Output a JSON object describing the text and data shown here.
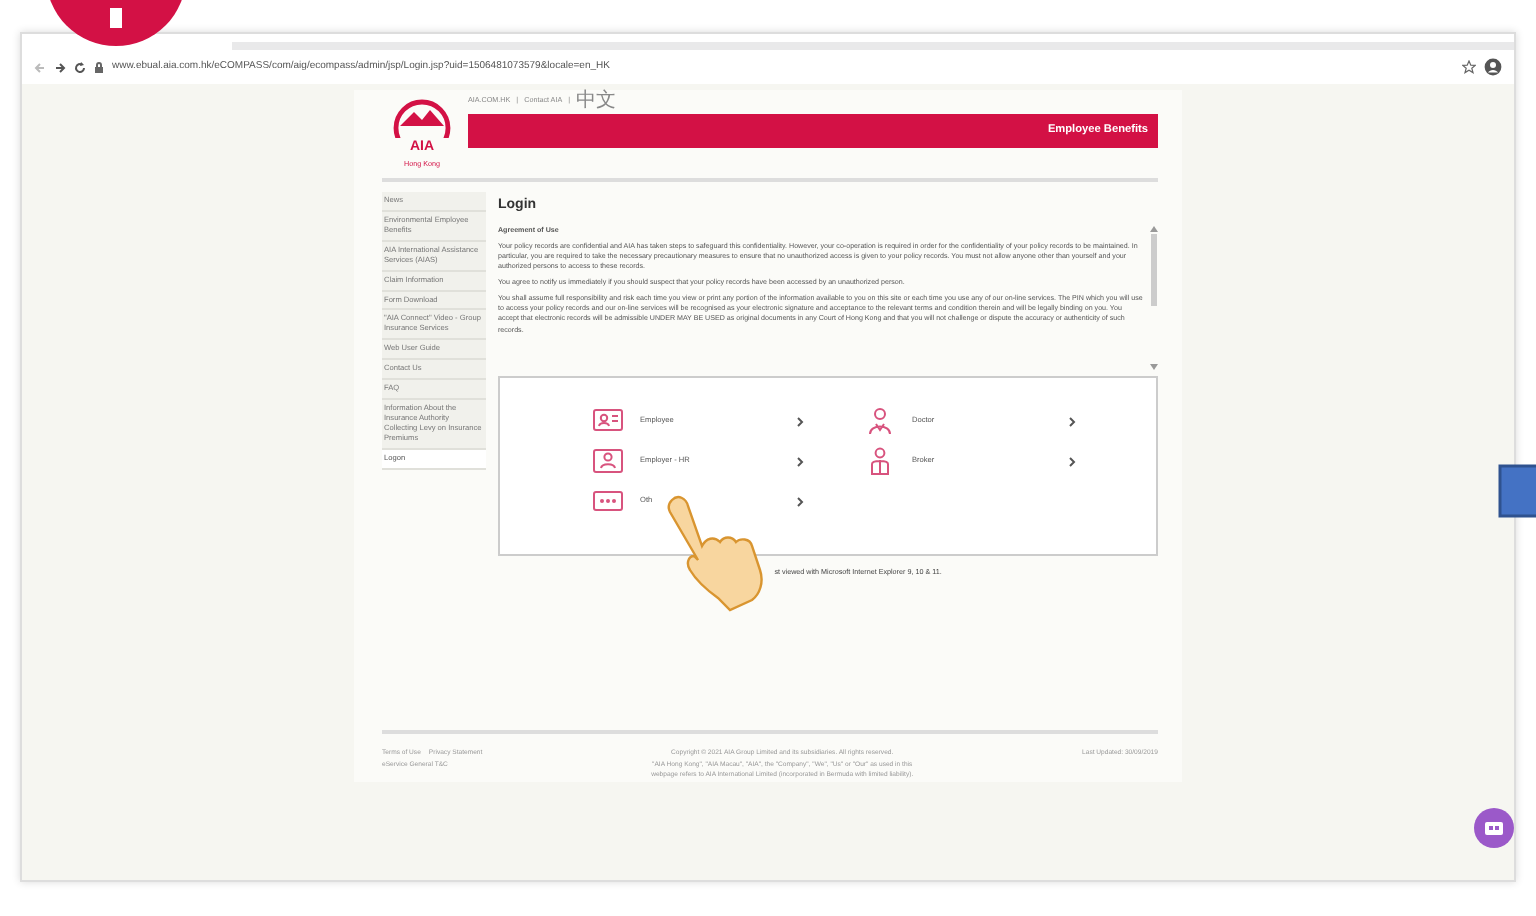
{
  "browser": {
    "url": "www.ebual.aia.com.hk/eCOMPASS/com/aig/ecompass/admin/jsp/Login.jsp?uid=1506481073579&locale=en_HK"
  },
  "header": {
    "logo_text": "AIA",
    "logo_caption": "Hong Kong",
    "top_links": [
      "AIA.COM.HK",
      "|",
      "Contact AIA",
      "|",
      "中文"
    ],
    "banner_title": "Employee Benefits"
  },
  "sidebar": {
    "items": [
      {
        "label": "News",
        "selected": false
      },
      {
        "label": "Environmental Employee Benefits",
        "selected": false
      },
      {
        "label": "AIA International Assistance Services (AIAS)",
        "selected": false
      },
      {
        "label": "Claim Information",
        "selected": false
      },
      {
        "label": "Form Download",
        "selected": false
      },
      {
        "label": "\"AIA Connect\" Video - Group Insurance Services",
        "selected": false
      },
      {
        "label": "Web User Guide",
        "selected": false
      },
      {
        "label": "Contact Us",
        "selected": false
      },
      {
        "label": "FAQ",
        "selected": false
      },
      {
        "label": "Information About the Insurance Authority Collecting Levy on Insurance Premiums",
        "selected": false
      },
      {
        "label": "Logon",
        "selected": true
      }
    ]
  },
  "main": {
    "title": "Login",
    "agreement_heading": "Agreement of Use",
    "paragraphs": [
      "Your policy records are confidential and AIA has taken steps to safeguard this confidentiality. However, your co-operation is required in order for the confidentiality of your policy records to be maintained. In particular, you are required to take the necessary precautionary measures to ensure that no unauthorized access is given to your policy records. You must not allow anyone other than yourself and your authorized persons to access to these records.",
      "You agree to notify us immediately if you should suspect that your policy records have been accessed by an unauthorized person.",
      "You shall assume full responsibility and risk each time you view or print any portion of the information available to you on this site or each time you use any of our on-line services. The PIN which you will use to access your policy records and our on-line services will be recognised as your electronic signature and acceptance to the relevant terms and condition therein and will be legally binding on you. You accept that electronic records will be admissible UNDER MAY BE USED as original documents in any Court of Hong Kong and that you will not challenge or dispute the accuracy or authenticity of such records."
    ],
    "options": [
      {
        "label": "Employee",
        "kind": "employee"
      },
      {
        "label": "Doctor",
        "kind": "doctor"
      },
      {
        "label": "Employer - HR",
        "kind": "employer"
      },
      {
        "label": "Broker",
        "kind": "broker"
      },
      {
        "label": "Oth",
        "kind": "others"
      }
    ],
    "note": "st viewed with Microsoft Internet Explorer 9, 10 & 11."
  },
  "footer": {
    "links": [
      "Terms of Use",
      "Privacy Statement",
      "eService General T&C"
    ],
    "copyright": [
      "Copyright © 2021 AIA Group Limited and its subsidiaries. All rights reserved.",
      "\"AIA Hong Kong\", \"AIA Macau\", \"AIA\", the \"Company\", \"We\", \"Us\" or \"Our\" as used in this",
      "webpage refers to AIA International Limited (incorporated in Bermuda with limited liability)."
    ],
    "updated": "Last Updated: 30/09/2019"
  }
}
